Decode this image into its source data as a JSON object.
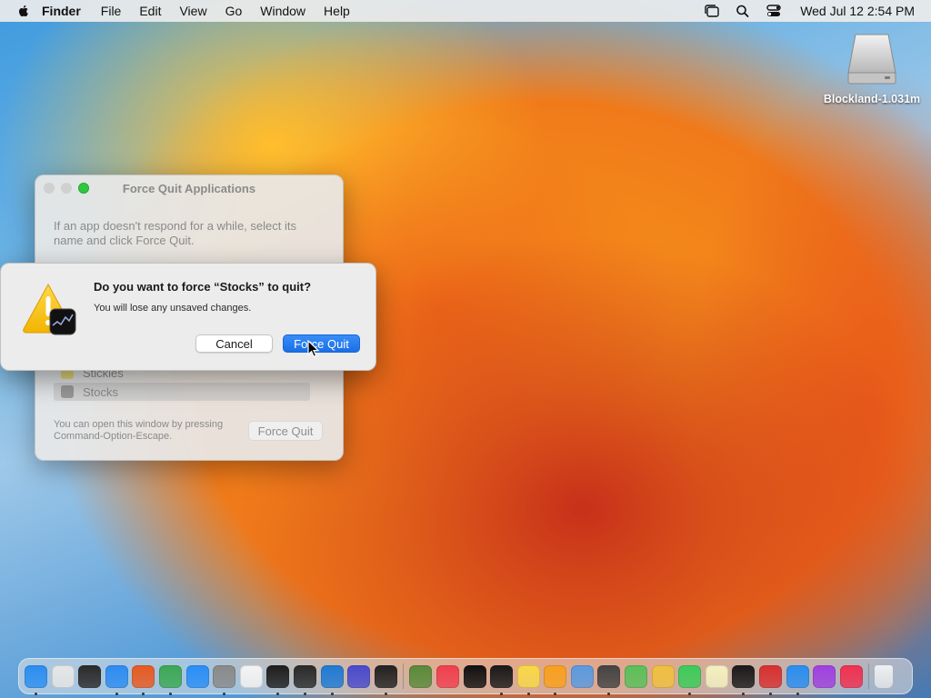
{
  "menubar": {
    "app_name": "Finder",
    "menus": [
      "File",
      "Edit",
      "View",
      "Go",
      "Window",
      "Help"
    ],
    "clock": "Wed Jul 12  2:54 PM"
  },
  "desktop": {
    "drive_label": "Blockland-1.031m"
  },
  "force_quit_window": {
    "title": "Force Quit Applications",
    "description": "If an app doesn't respond for a while, select its name and click Force Quit.",
    "apps": [
      {
        "name": "Stickies",
        "color": "#e8d86a"
      },
      {
        "name": "Stocks",
        "color": "#3a3a3a",
        "selected": true
      }
    ],
    "hint": "You can open this window by pressing Command-Option-Escape.",
    "force_quit_label": "Force Quit"
  },
  "alert": {
    "title": "Do you want to force “Stocks” to quit?",
    "message": "You will lose any unsaved changes.",
    "cancel_label": "Cancel",
    "force_quit_label": "Force Quit"
  },
  "dock": {
    "apps": [
      {
        "name": "finder-icon",
        "color": "#2b8ef0"
      },
      {
        "name": "launchpad-icon",
        "color": "#e6e6e6"
      },
      {
        "name": "mission-control-icon",
        "color": "#2a2a2a"
      },
      {
        "name": "safari-icon",
        "color": "#2d8cf0"
      },
      {
        "name": "firefox-icon",
        "color": "#e85a20"
      },
      {
        "name": "chrome-icon",
        "color": "#3ca854"
      },
      {
        "name": "app-store-icon",
        "color": "#2a8ef6"
      },
      {
        "name": "system-settings-icon",
        "color": "#8a8a8a"
      },
      {
        "name": "textedit-icon",
        "color": "#f4f4f4"
      },
      {
        "name": "terminal-icon",
        "color": "#1e1e1e"
      },
      {
        "name": "garageband-icon",
        "color": "#2a2a2a"
      },
      {
        "name": "vscode-icon",
        "color": "#1f7ad4"
      },
      {
        "name": "shortcuts-icon",
        "color": "#4a4acd"
      },
      {
        "name": "console-icon",
        "color": "#222222"
      },
      {
        "name": "minecraft-icon",
        "color": "#5a8a3a"
      },
      {
        "name": "news-icon",
        "color": "#f04050"
      },
      {
        "name": "apple-tv-icon",
        "color": "#111111"
      },
      {
        "name": "stocks-icon",
        "color": "#1a1a1a"
      },
      {
        "name": "notes-icon",
        "color": "#f8d84a"
      },
      {
        "name": "home-icon",
        "color": "#f8a020"
      },
      {
        "name": "preview-icon",
        "color": "#5a9ae0"
      },
      {
        "name": "screenshot-icon",
        "color": "#444444"
      },
      {
        "name": "maps-icon",
        "color": "#5ac05a"
      },
      {
        "name": "photos-icon",
        "color": "#f0c040"
      },
      {
        "name": "messages-icon",
        "color": "#3ccc5a"
      },
      {
        "name": "stickies-icon",
        "color": "#f4f0c0"
      },
      {
        "name": "voice-memos-icon",
        "color": "#1a1a1a"
      },
      {
        "name": "solitaire-icon",
        "color": "#d83030"
      },
      {
        "name": "mail-icon",
        "color": "#2a8ef0"
      },
      {
        "name": "podcasts-icon",
        "color": "#a040e0"
      },
      {
        "name": "music-icon",
        "color": "#f03050"
      }
    ],
    "trash": {
      "name": "trash-icon",
      "color": "#d8dce0"
    }
  }
}
